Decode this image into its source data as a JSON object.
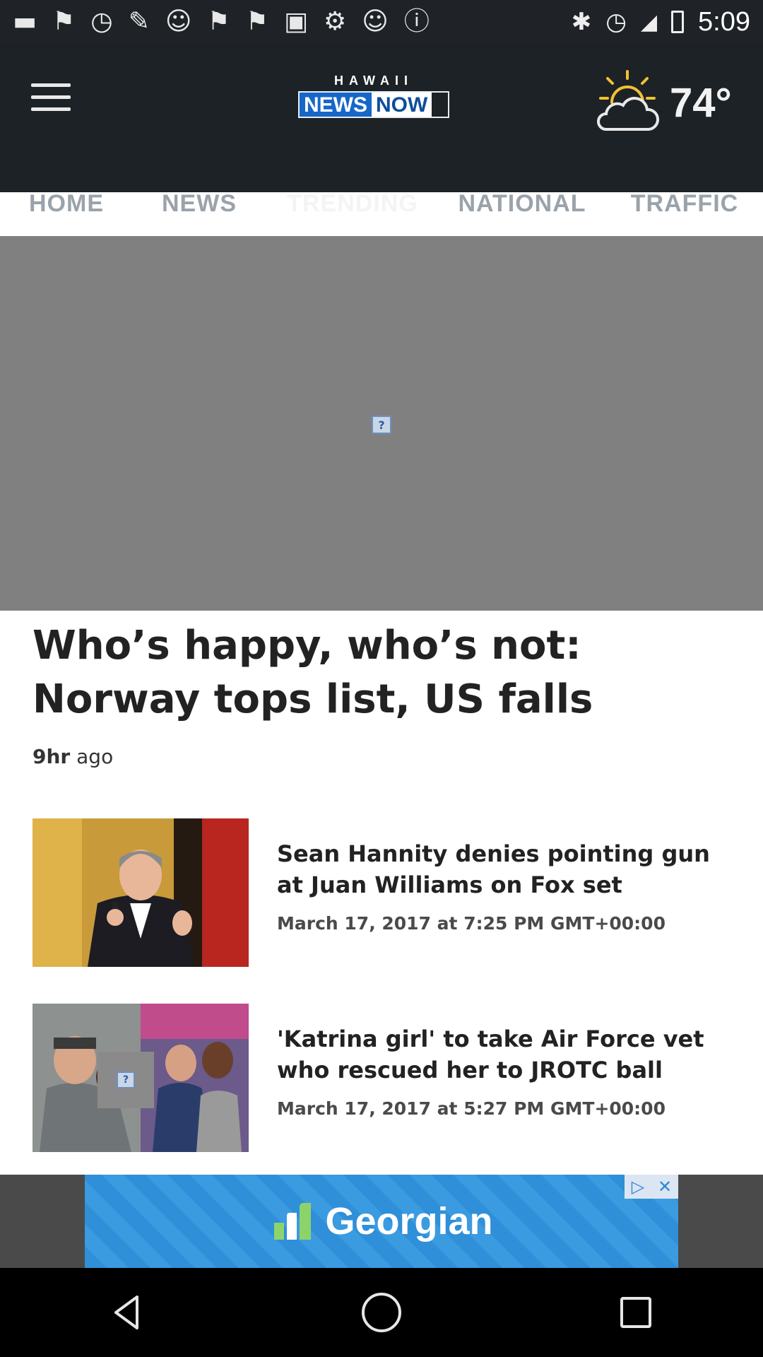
{
  "status_bar": {
    "time": "5:09",
    "icons": [
      "chat-icon",
      "flag-icon",
      "alarm-icon",
      "wrench-icon",
      "smiley-icon",
      "flag-icon",
      "flag-icon",
      "qr-icon",
      "apps-icon",
      "smiley-icon",
      "info-icon",
      "bluetooth-icon",
      "alarm-icon",
      "signal-icon",
      "battery-icon"
    ]
  },
  "header": {
    "logo_top": "HAWAII",
    "logo_news": "NEWS",
    "logo_now": "NOW",
    "temperature": "74°"
  },
  "tabs": [
    {
      "label": "HOME",
      "active": false
    },
    {
      "label": "NEWS",
      "active": false
    },
    {
      "label": "TRENDING",
      "active": true
    },
    {
      "label": "NATIONAL",
      "active": false
    },
    {
      "label": "TRAFFIC",
      "active": false
    }
  ],
  "hero": {
    "headline": "Who’s happy, who’s not: Norway tops list, US falls",
    "time_bold": "9hr",
    "time_rest": " ago"
  },
  "stories": [
    {
      "title": "Sean Hannity denies pointing gun at Juan Williams on Fox set",
      "date": "March 17, 2017 at 7:25 PM GMT+00:00"
    },
    {
      "title": "'Katrina girl' to take Air Force vet who rescued her to JROTC ball",
      "date": "March 17, 2017 at 5:27 PM GMT+00:00"
    }
  ],
  "ad": {
    "label": "Georgian",
    "adchoices": "▷",
    "close": "✕"
  },
  "colors": {
    "header_bg": "#1d2227",
    "tab_active": "#f4f4f4",
    "tab_inactive": "#9aa2aa",
    "ad_blue": "#2f8fd8"
  }
}
